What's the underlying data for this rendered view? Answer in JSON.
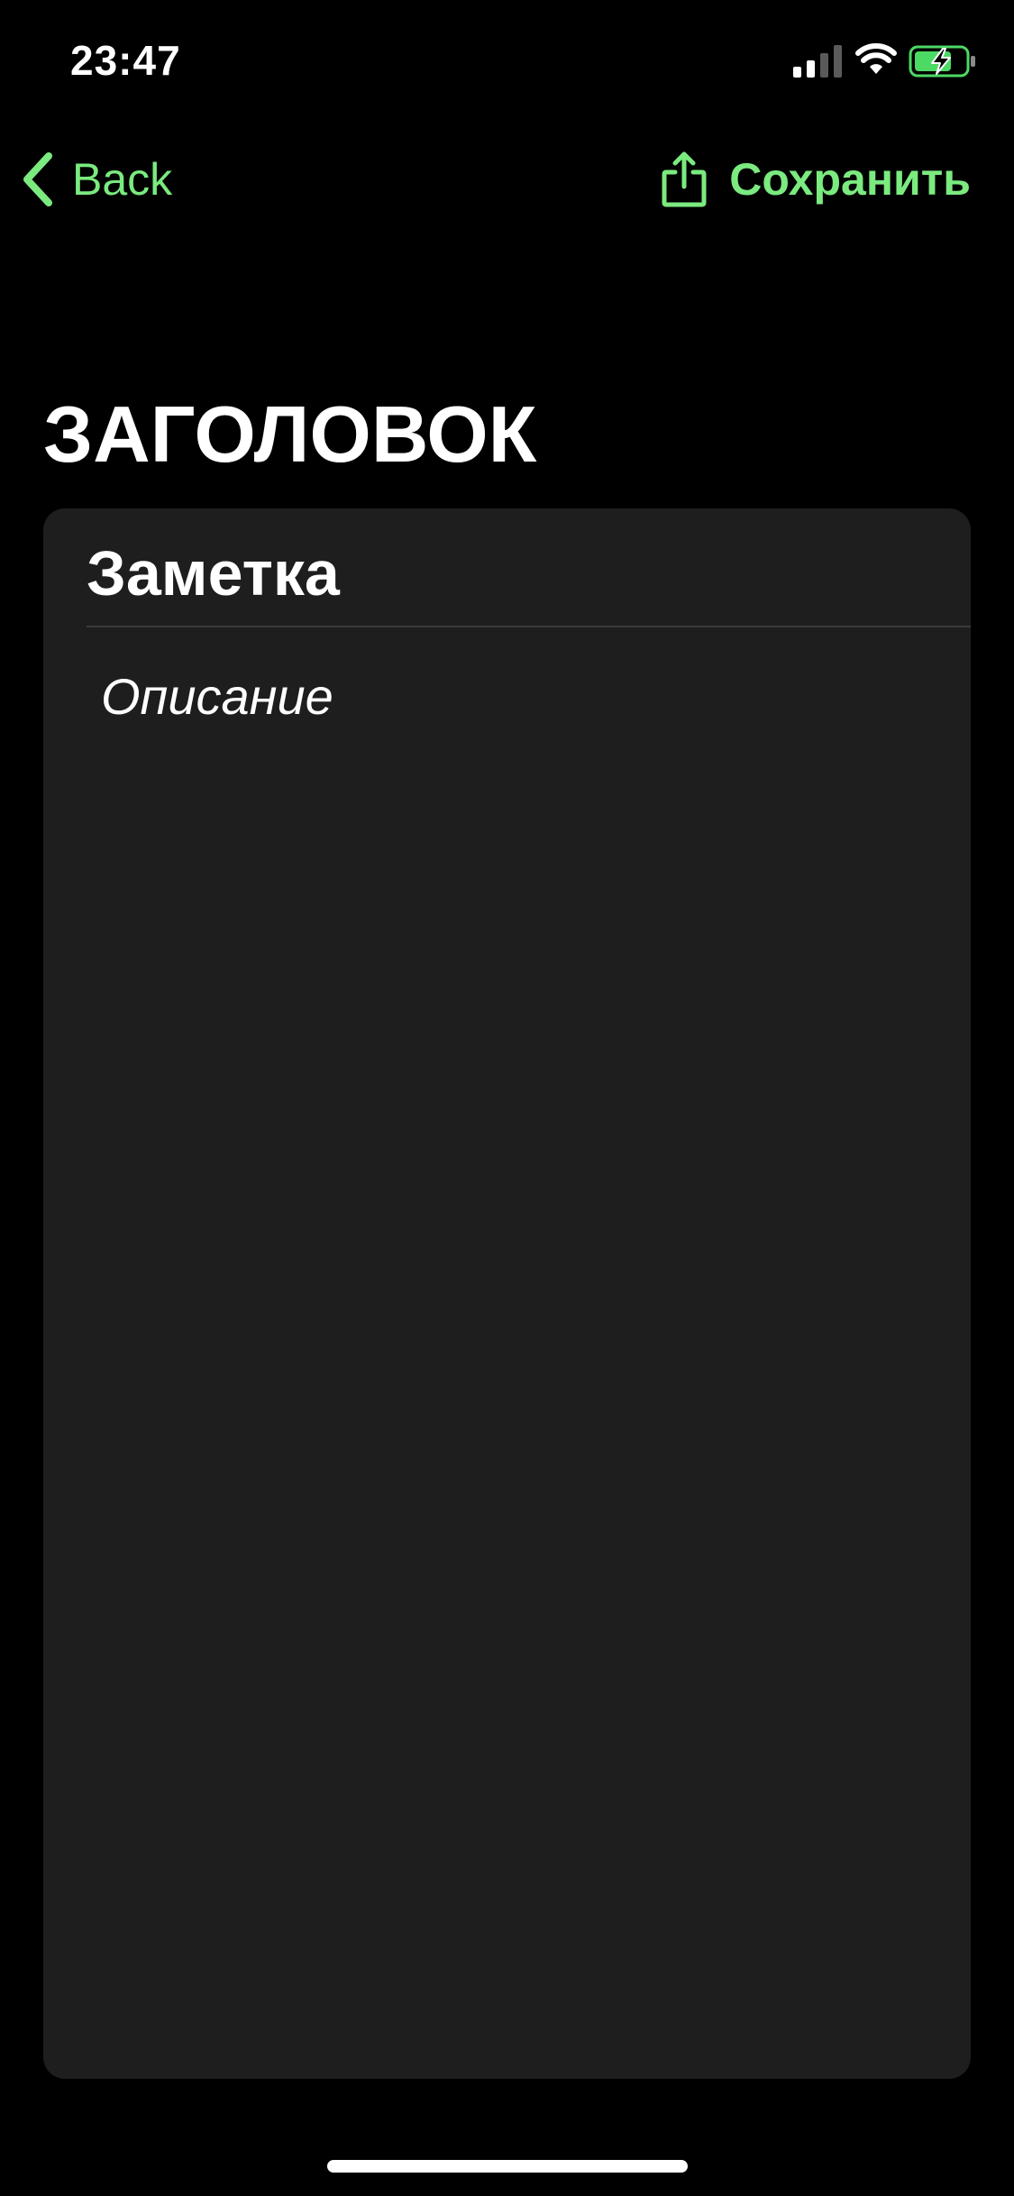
{
  "status_bar": {
    "time": "23:47",
    "icons": [
      "cellular-signal-icon",
      "wifi-icon",
      "battery-charging-icon"
    ]
  },
  "nav": {
    "back_label": "Back",
    "save_label": "Сохранить",
    "back_icon": "chevron-left-icon",
    "save_icon": "share-icon"
  },
  "page": {
    "title": "ЗАГОЛОВОК"
  },
  "note": {
    "title_value": "Заметка",
    "description_value": "Описание"
  },
  "colors": {
    "accent": "#7bea7f",
    "background": "#000000",
    "card": "#1e1e1e",
    "divider": "#3a3a3c",
    "battery_fill": "#4cd964"
  }
}
